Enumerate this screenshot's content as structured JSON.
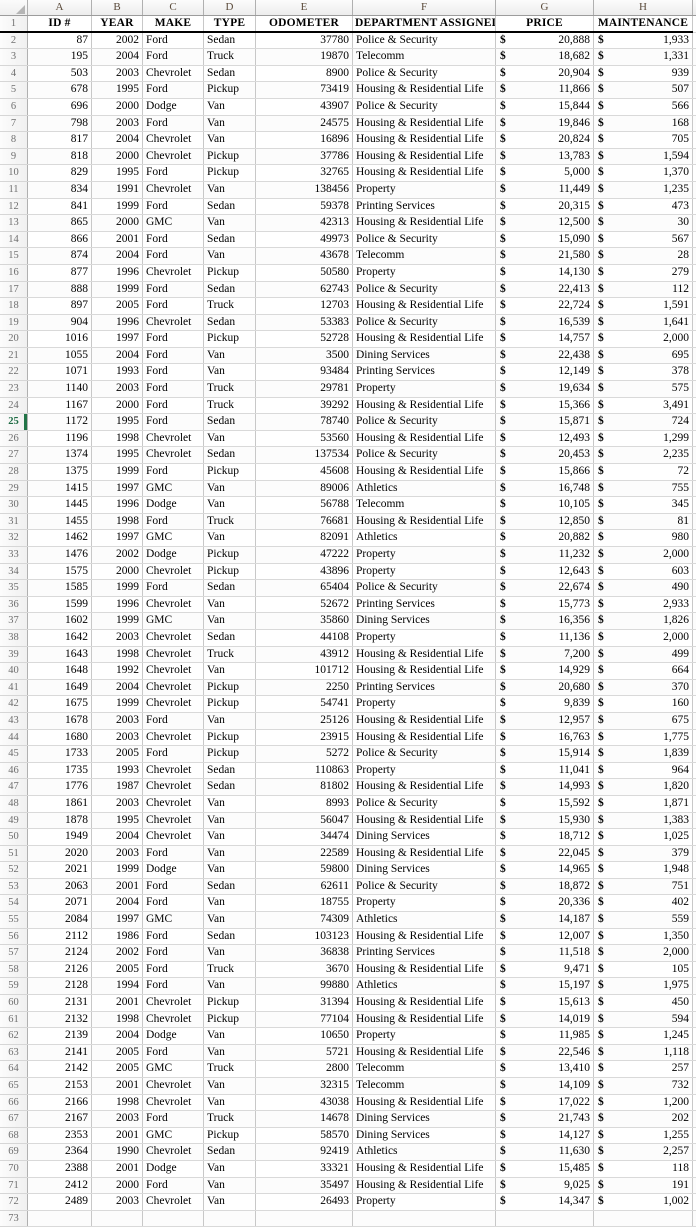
{
  "app": {
    "type": "spreadsheet",
    "selected_row": 25,
    "accent_color": "#217346",
    "gridline_color": "#d9d9d9"
  },
  "column_headers": [
    "A",
    "B",
    "C",
    "D",
    "E",
    "F",
    "G",
    "H"
  ],
  "table": {
    "header_row_number": 1,
    "headers": [
      "ID #",
      "YEAR",
      "MAKE",
      "TYPE",
      "ODOMETER",
      "DEPARTMENT ASSIGNED",
      "PRICE",
      "MAINTENANCE"
    ],
    "currency_symbol": "$",
    "rows": [
      {
        "r": 2,
        "id": "87",
        "year": "2002",
        "make": "Ford",
        "type": "Sedan",
        "odometer": "37780",
        "dept": "Police & Security",
        "price": "20,888",
        "maint": "1,933"
      },
      {
        "r": 3,
        "id": "195",
        "year": "2004",
        "make": "Ford",
        "type": "Truck",
        "odometer": "19870",
        "dept": "Telecomm",
        "price": "18,682",
        "maint": "1,331"
      },
      {
        "r": 4,
        "id": "503",
        "year": "2003",
        "make": "Chevrolet",
        "type": "Sedan",
        "odometer": "8900",
        "dept": "Police & Security",
        "price": "20,904",
        "maint": "939"
      },
      {
        "r": 5,
        "id": "678",
        "year": "1995",
        "make": "Ford",
        "type": "Pickup",
        "odometer": "73419",
        "dept": "Housing & Residential Life",
        "price": "11,866",
        "maint": "507"
      },
      {
        "r": 6,
        "id": "696",
        "year": "2000",
        "make": "Dodge",
        "type": "Van",
        "odometer": "43907",
        "dept": "Police & Security",
        "price": "15,844",
        "maint": "566"
      },
      {
        "r": 7,
        "id": "798",
        "year": "2003",
        "make": "Ford",
        "type": "Van",
        "odometer": "24575",
        "dept": "Housing & Residential Life",
        "price": "19,846",
        "maint": "168"
      },
      {
        "r": 8,
        "id": "817",
        "year": "2004",
        "make": "Chevrolet",
        "type": "Van",
        "odometer": "16896",
        "dept": "Housing & Residential Life",
        "price": "20,824",
        "maint": "705"
      },
      {
        "r": 9,
        "id": "818",
        "year": "2000",
        "make": "Chevrolet",
        "type": "Pickup",
        "odometer": "37786",
        "dept": "Housing & Residential Life",
        "price": "13,783",
        "maint": "1,594"
      },
      {
        "r": 10,
        "id": "829",
        "year": "1995",
        "make": "Ford",
        "type": "Pickup",
        "odometer": "32765",
        "dept": "Housing & Residential Life",
        "price": "5,000",
        "maint": "1,370"
      },
      {
        "r": 11,
        "id": "834",
        "year": "1991",
        "make": "Chevrolet",
        "type": "Van",
        "odometer": "138456",
        "dept": "Property",
        "price": "11,449",
        "maint": "1,235"
      },
      {
        "r": 12,
        "id": "841",
        "year": "1999",
        "make": "Ford",
        "type": "Sedan",
        "odometer": "59378",
        "dept": "Printing Services",
        "price": "20,315",
        "maint": "473"
      },
      {
        "r": 13,
        "id": "865",
        "year": "2000",
        "make": "GMC",
        "type": "Van",
        "odometer": "42313",
        "dept": "Housing & Residential Life",
        "price": "12,500",
        "maint": "30"
      },
      {
        "r": 14,
        "id": "866",
        "year": "2001",
        "make": "Ford",
        "type": "Sedan",
        "odometer": "49973",
        "dept": "Police & Security",
        "price": "15,090",
        "maint": "567"
      },
      {
        "r": 15,
        "id": "874",
        "year": "2004",
        "make": "Ford",
        "type": "Van",
        "odometer": "43678",
        "dept": "Telecomm",
        "price": "21,580",
        "maint": "28"
      },
      {
        "r": 16,
        "id": "877",
        "year": "1996",
        "make": "Chevrolet",
        "type": "Pickup",
        "odometer": "50580",
        "dept": "Property",
        "price": "14,130",
        "maint": "279"
      },
      {
        "r": 17,
        "id": "888",
        "year": "1999",
        "make": "Ford",
        "type": "Sedan",
        "odometer": "62743",
        "dept": "Police & Security",
        "price": "22,413",
        "maint": "112"
      },
      {
        "r": 18,
        "id": "897",
        "year": "2005",
        "make": "Ford",
        "type": "Truck",
        "odometer": "12703",
        "dept": "Housing & Residential Life",
        "price": "22,724",
        "maint": "1,591"
      },
      {
        "r": 19,
        "id": "904",
        "year": "1996",
        "make": "Chevrolet",
        "type": "Sedan",
        "odometer": "53383",
        "dept": "Police & Security",
        "price": "16,539",
        "maint": "1,641"
      },
      {
        "r": 20,
        "id": "1016",
        "year": "1997",
        "make": "Ford",
        "type": "Pickup",
        "odometer": "52728",
        "dept": "Housing & Residential Life",
        "price": "14,757",
        "maint": "2,000"
      },
      {
        "r": 21,
        "id": "1055",
        "year": "2004",
        "make": "Ford",
        "type": "Van",
        "odometer": "3500",
        "dept": "Dining Services",
        "price": "22,438",
        "maint": "695"
      },
      {
        "r": 22,
        "id": "1071",
        "year": "1993",
        "make": "Ford",
        "type": "Van",
        "odometer": "93484",
        "dept": "Printing Services",
        "price": "12,149",
        "maint": "378"
      },
      {
        "r": 23,
        "id": "1140",
        "year": "2003",
        "make": "Ford",
        "type": "Truck",
        "odometer": "29781",
        "dept": "Property",
        "price": "19,634",
        "maint": "575"
      },
      {
        "r": 24,
        "id": "1167",
        "year": "2000",
        "make": "Ford",
        "type": "Truck",
        "odometer": "39292",
        "dept": "Housing & Residential Life",
        "price": "15,366",
        "maint": "3,491"
      },
      {
        "r": 25,
        "id": "1172",
        "year": "1995",
        "make": "Ford",
        "type": "Sedan",
        "odometer": "78740",
        "dept": "Police & Security",
        "price": "15,871",
        "maint": "724"
      },
      {
        "r": 26,
        "id": "1196",
        "year": "1998",
        "make": "Chevrolet",
        "type": "Van",
        "odometer": "53560",
        "dept": "Housing & Residential Life",
        "price": "12,493",
        "maint": "1,299"
      },
      {
        "r": 27,
        "id": "1374",
        "year": "1995",
        "make": "Chevrolet",
        "type": "Sedan",
        "odometer": "137534",
        "dept": "Police & Security",
        "price": "20,453",
        "maint": "2,235"
      },
      {
        "r": 28,
        "id": "1375",
        "year": "1999",
        "make": "Ford",
        "type": "Pickup",
        "odometer": "45608",
        "dept": "Housing & Residential Life",
        "price": "15,866",
        "maint": "72"
      },
      {
        "r": 29,
        "id": "1415",
        "year": "1997",
        "make": "GMC",
        "type": "Van",
        "odometer": "89006",
        "dept": "Athletics",
        "price": "16,748",
        "maint": "755"
      },
      {
        "r": 30,
        "id": "1445",
        "year": "1996",
        "make": "Dodge",
        "type": "Van",
        "odometer": "56788",
        "dept": "Telecomm",
        "price": "10,105",
        "maint": "345"
      },
      {
        "r": 31,
        "id": "1455",
        "year": "1998",
        "make": "Ford",
        "type": "Truck",
        "odometer": "76681",
        "dept": "Housing & Residential Life",
        "price": "12,850",
        "maint": "81"
      },
      {
        "r": 32,
        "id": "1462",
        "year": "1997",
        "make": "GMC",
        "type": "Van",
        "odometer": "82091",
        "dept": "Athletics",
        "price": "20,882",
        "maint": "980"
      },
      {
        "r": 33,
        "id": "1476",
        "year": "2002",
        "make": "Dodge",
        "type": "Pickup",
        "odometer": "47222",
        "dept": "Property",
        "price": "11,232",
        "maint": "2,000"
      },
      {
        "r": 34,
        "id": "1575",
        "year": "2000",
        "make": "Chevrolet",
        "type": "Pickup",
        "odometer": "43896",
        "dept": "Property",
        "price": "12,643",
        "maint": "603"
      },
      {
        "r": 35,
        "id": "1585",
        "year": "1999",
        "make": "Ford",
        "type": "Sedan",
        "odometer": "65404",
        "dept": "Police & Security",
        "price": "22,674",
        "maint": "490"
      },
      {
        "r": 36,
        "id": "1599",
        "year": "1996",
        "make": "Chevrolet",
        "type": "Van",
        "odometer": "52672",
        "dept": "Printing Services",
        "price": "15,773",
        "maint": "2,933"
      },
      {
        "r": 37,
        "id": "1602",
        "year": "1999",
        "make": "GMC",
        "type": "Van",
        "odometer": "35860",
        "dept": "Dining Services",
        "price": "16,356",
        "maint": "1,826"
      },
      {
        "r": 38,
        "id": "1642",
        "year": "2003",
        "make": "Chevrolet",
        "type": "Sedan",
        "odometer": "44108",
        "dept": "Property",
        "price": "11,136",
        "maint": "2,000"
      },
      {
        "r": 39,
        "id": "1643",
        "year": "1998",
        "make": "Chevrolet",
        "type": "Truck",
        "odometer": "43912",
        "dept": "Housing & Residential Life",
        "price": "7,200",
        "maint": "499"
      },
      {
        "r": 40,
        "id": "1648",
        "year": "1992",
        "make": "Chevrolet",
        "type": "Van",
        "odometer": "101712",
        "dept": "Housing & Residential Life",
        "price": "14,929",
        "maint": "664"
      },
      {
        "r": 41,
        "id": "1649",
        "year": "2004",
        "make": "Chevrolet",
        "type": "Pickup",
        "odometer": "2250",
        "dept": "Printing Services",
        "price": "20,680",
        "maint": "370"
      },
      {
        "r": 42,
        "id": "1675",
        "year": "1999",
        "make": "Chevrolet",
        "type": "Pickup",
        "odometer": "54741",
        "dept": "Property",
        "price": "9,839",
        "maint": "160"
      },
      {
        "r": 43,
        "id": "1678",
        "year": "2003",
        "make": "Ford",
        "type": "Van",
        "odometer": "25126",
        "dept": "Housing & Residential Life",
        "price": "12,957",
        "maint": "675"
      },
      {
        "r": 44,
        "id": "1680",
        "year": "2003",
        "make": "Chevrolet",
        "type": "Pickup",
        "odometer": "23915",
        "dept": "Housing & Residential Life",
        "price": "16,763",
        "maint": "1,775"
      },
      {
        "r": 45,
        "id": "1733",
        "year": "2005",
        "make": "Ford",
        "type": "Pickup",
        "odometer": "5272",
        "dept": "Police & Security",
        "price": "15,914",
        "maint": "1,839"
      },
      {
        "r": 46,
        "id": "1735",
        "year": "1993",
        "make": "Chevrolet",
        "type": "Sedan",
        "odometer": "110863",
        "dept": "Property",
        "price": "11,041",
        "maint": "964"
      },
      {
        "r": 47,
        "id": "1776",
        "year": "1987",
        "make": "Chevrolet",
        "type": "Sedan",
        "odometer": "81802",
        "dept": "Housing & Residential Life",
        "price": "14,993",
        "maint": "1,820"
      },
      {
        "r": 48,
        "id": "1861",
        "year": "2003",
        "make": "Chevrolet",
        "type": "Van",
        "odometer": "8993",
        "dept": "Police & Security",
        "price": "15,592",
        "maint": "1,871"
      },
      {
        "r": 49,
        "id": "1878",
        "year": "1995",
        "make": "Chevrolet",
        "type": "Van",
        "odometer": "56047",
        "dept": "Housing & Residential Life",
        "price": "15,930",
        "maint": "1,383"
      },
      {
        "r": 50,
        "id": "1949",
        "year": "2004",
        "make": "Chevrolet",
        "type": "Van",
        "odometer": "34474",
        "dept": "Dining Services",
        "price": "18,712",
        "maint": "1,025"
      },
      {
        "r": 51,
        "id": "2020",
        "year": "2003",
        "make": "Ford",
        "type": "Van",
        "odometer": "22589",
        "dept": "Housing & Residential Life",
        "price": "22,045",
        "maint": "379"
      },
      {
        "r": 52,
        "id": "2021",
        "year": "1999",
        "make": "Dodge",
        "type": "Van",
        "odometer": "59800",
        "dept": "Dining Services",
        "price": "14,965",
        "maint": "1,948"
      },
      {
        "r": 53,
        "id": "2063",
        "year": "2001",
        "make": "Ford",
        "type": "Sedan",
        "odometer": "62611",
        "dept": "Police & Security",
        "price": "18,872",
        "maint": "751"
      },
      {
        "r": 54,
        "id": "2071",
        "year": "2004",
        "make": "Ford",
        "type": "Van",
        "odometer": "18755",
        "dept": "Property",
        "price": "20,336",
        "maint": "402"
      },
      {
        "r": 55,
        "id": "2084",
        "year": "1997",
        "make": "GMC",
        "type": "Van",
        "odometer": "74309",
        "dept": "Athletics",
        "price": "14,187",
        "maint": "559"
      },
      {
        "r": 56,
        "id": "2112",
        "year": "1986",
        "make": "Ford",
        "type": "Sedan",
        "odometer": "103123",
        "dept": "Housing & Residential Life",
        "price": "12,007",
        "maint": "1,350"
      },
      {
        "r": 57,
        "id": "2124",
        "year": "2002",
        "make": "Ford",
        "type": "Van",
        "odometer": "36838",
        "dept": "Printing Services",
        "price": "11,518",
        "maint": "2,000"
      },
      {
        "r": 58,
        "id": "2126",
        "year": "2005",
        "make": "Ford",
        "type": "Truck",
        "odometer": "3670",
        "dept": "Housing & Residential Life",
        "price": "9,471",
        "maint": "105"
      },
      {
        "r": 59,
        "id": "2128",
        "year": "1994",
        "make": "Ford",
        "type": "Van",
        "odometer": "99880",
        "dept": "Athletics",
        "price": "15,197",
        "maint": "1,975"
      },
      {
        "r": 60,
        "id": "2131",
        "year": "2001",
        "make": "Chevrolet",
        "type": "Pickup",
        "odometer": "31394",
        "dept": "Housing & Residential Life",
        "price": "15,613",
        "maint": "450"
      },
      {
        "r": 61,
        "id": "2132",
        "year": "1998",
        "make": "Chevrolet",
        "type": "Pickup",
        "odometer": "77104",
        "dept": "Housing & Residential Life",
        "price": "14,019",
        "maint": "594"
      },
      {
        "r": 62,
        "id": "2139",
        "year": "2004",
        "make": "Dodge",
        "type": "Van",
        "odometer": "10650",
        "dept": "Property",
        "price": "11,985",
        "maint": "1,245"
      },
      {
        "r": 63,
        "id": "2141",
        "year": "2005",
        "make": "Ford",
        "type": "Van",
        "odometer": "5721",
        "dept": "Housing & Residential Life",
        "price": "22,546",
        "maint": "1,118"
      },
      {
        "r": 64,
        "id": "2142",
        "year": "2005",
        "make": "GMC",
        "type": "Truck",
        "odometer": "2800",
        "dept": "Telecomm",
        "price": "13,410",
        "maint": "257"
      },
      {
        "r": 65,
        "id": "2153",
        "year": "2001",
        "make": "Chevrolet",
        "type": "Van",
        "odometer": "32315",
        "dept": "Telecomm",
        "price": "14,109",
        "maint": "732"
      },
      {
        "r": 66,
        "id": "2166",
        "year": "1998",
        "make": "Chevrolet",
        "type": "Van",
        "odometer": "43038",
        "dept": "Housing & Residential Life",
        "price": "17,022",
        "maint": "1,200"
      },
      {
        "r": 67,
        "id": "2167",
        "year": "2003",
        "make": "Ford",
        "type": "Truck",
        "odometer": "14678",
        "dept": "Dining Services",
        "price": "21,743",
        "maint": "202"
      },
      {
        "r": 68,
        "id": "2353",
        "year": "2001",
        "make": "GMC",
        "type": "Pickup",
        "odometer": "58570",
        "dept": "Dining Services",
        "price": "14,127",
        "maint": "1,255"
      },
      {
        "r": 69,
        "id": "2364",
        "year": "1990",
        "make": "Chevrolet",
        "type": "Sedan",
        "odometer": "92419",
        "dept": "Athletics",
        "price": "11,630",
        "maint": "2,257"
      },
      {
        "r": 70,
        "id": "2388",
        "year": "2001",
        "make": "Dodge",
        "type": "Van",
        "odometer": "33321",
        "dept": "Housing & Residential Life",
        "price": "15,485",
        "maint": "118"
      },
      {
        "r": 71,
        "id": "2412",
        "year": "2000",
        "make": "Ford",
        "type": "Van",
        "odometer": "35497",
        "dept": "Housing & Residential Life",
        "price": "9,025",
        "maint": "191"
      },
      {
        "r": 72,
        "id": "2489",
        "year": "2003",
        "make": "Chevrolet",
        "type": "Van",
        "odometer": "26493",
        "dept": "Property",
        "price": "14,347",
        "maint": "1,002"
      },
      {
        "r": 73,
        "id": "",
        "year": "",
        "make": "",
        "type": "",
        "odometer": "",
        "dept": "",
        "price": "",
        "maint": ""
      }
    ]
  }
}
